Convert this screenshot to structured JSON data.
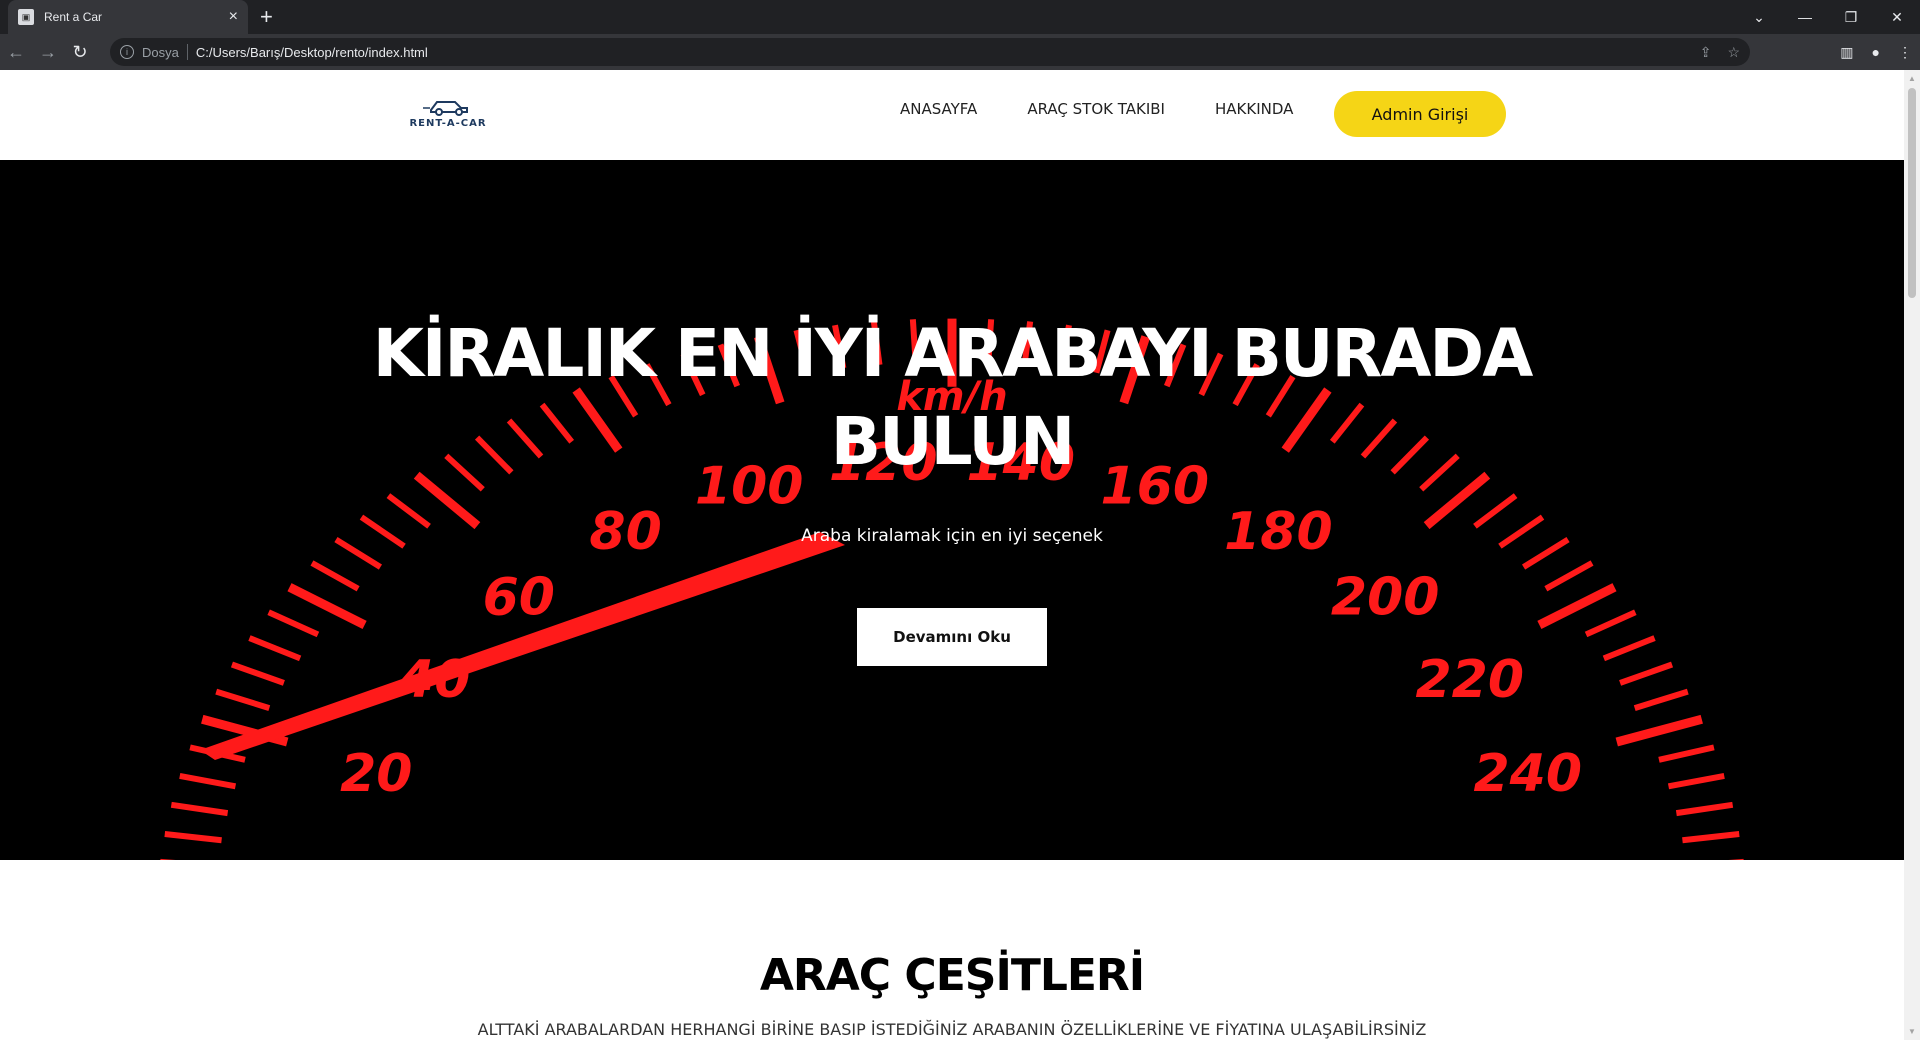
{
  "browser": {
    "tab_title": "Rent a Car",
    "scheme_label": "Dosya",
    "url": "C:/Users/Barış/Desktop/rento/index.html"
  },
  "site": {
    "logo_text": "RENT-A-CAR",
    "nav": [
      {
        "label": "ANASAYFA"
      },
      {
        "label": "ARAÇ STOK TAKIBI"
      },
      {
        "label": "HAKKINDA"
      }
    ],
    "admin_button": "Admin Girişi"
  },
  "hero": {
    "title_line1": "KİRALIK EN İYİ ARABAYI BURADA",
    "title_line2": "BULUN",
    "subtitle": "Araba kiralamak için en iyi seçenek",
    "button": "Devamını Oku",
    "speedometer_labels": [
      "20",
      "40",
      "60",
      "80",
      "100",
      "120",
      "140",
      "160",
      "180",
      "200",
      "220",
      "240"
    ],
    "unit": "km/h"
  },
  "section": {
    "title": "ARAÇ ÇEŞİTLERİ",
    "subtitle": "ALTTAKİ ARABALARDAN HERHANGİ BİRİNE BASIP İSTEDİĞİNİZ ARABANIN ÖZELLİKLERİNE VE FİYATINA ULAŞABİLİRSİNİZ"
  },
  "colors": {
    "accent": "#f5d516",
    "gauge_red": "#ff1a1a"
  }
}
